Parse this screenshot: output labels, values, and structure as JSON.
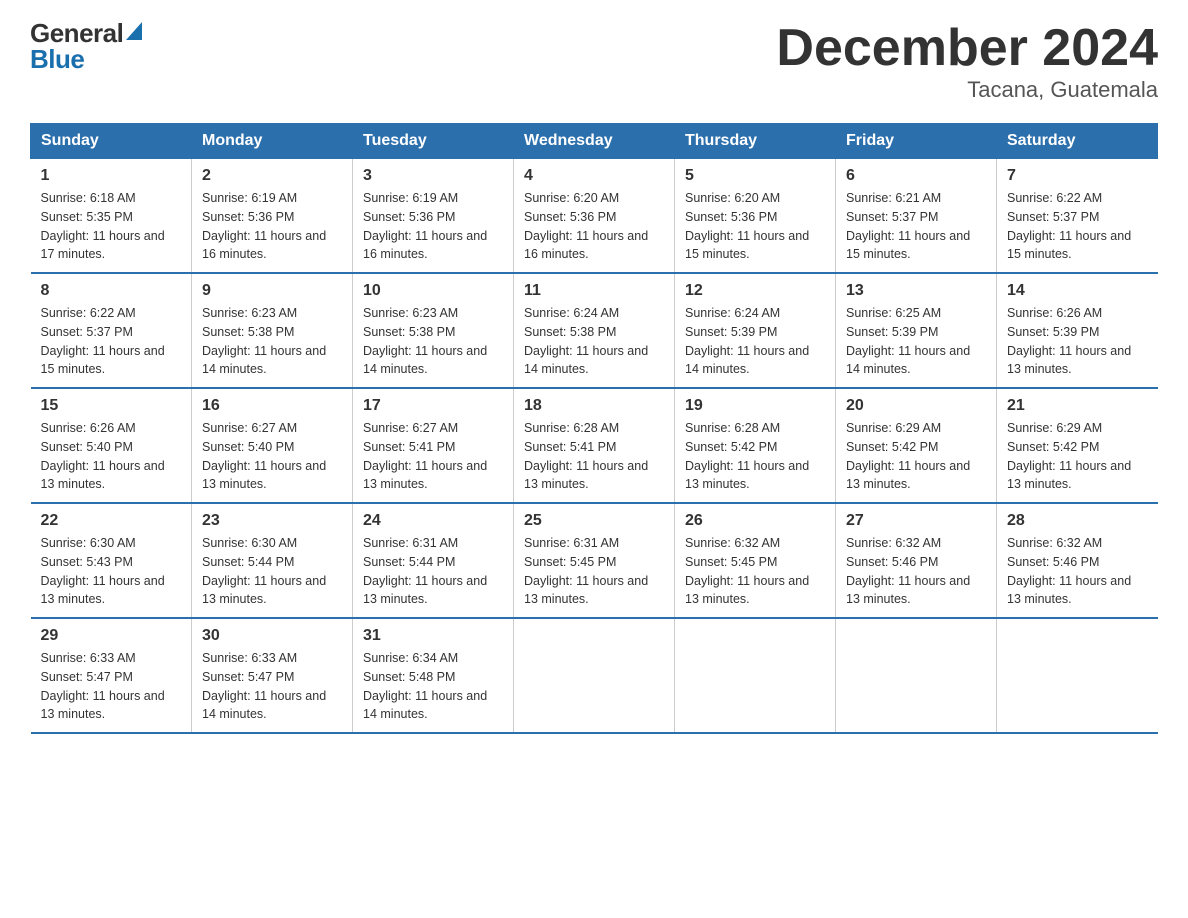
{
  "logo": {
    "general": "General",
    "blue": "Blue"
  },
  "title": "December 2024",
  "subtitle": "Tacana, Guatemala",
  "days_header": [
    "Sunday",
    "Monday",
    "Tuesday",
    "Wednesday",
    "Thursday",
    "Friday",
    "Saturday"
  ],
  "weeks": [
    [
      {
        "day": "1",
        "sunrise": "6:18 AM",
        "sunset": "5:35 PM",
        "daylight": "11 hours and 17 minutes."
      },
      {
        "day": "2",
        "sunrise": "6:19 AM",
        "sunset": "5:36 PM",
        "daylight": "11 hours and 16 minutes."
      },
      {
        "day": "3",
        "sunrise": "6:19 AM",
        "sunset": "5:36 PM",
        "daylight": "11 hours and 16 minutes."
      },
      {
        "day": "4",
        "sunrise": "6:20 AM",
        "sunset": "5:36 PM",
        "daylight": "11 hours and 16 minutes."
      },
      {
        "day": "5",
        "sunrise": "6:20 AM",
        "sunset": "5:36 PM",
        "daylight": "11 hours and 15 minutes."
      },
      {
        "day": "6",
        "sunrise": "6:21 AM",
        "sunset": "5:37 PM",
        "daylight": "11 hours and 15 minutes."
      },
      {
        "day": "7",
        "sunrise": "6:22 AM",
        "sunset": "5:37 PM",
        "daylight": "11 hours and 15 minutes."
      }
    ],
    [
      {
        "day": "8",
        "sunrise": "6:22 AM",
        "sunset": "5:37 PM",
        "daylight": "11 hours and 15 minutes."
      },
      {
        "day": "9",
        "sunrise": "6:23 AM",
        "sunset": "5:38 PM",
        "daylight": "11 hours and 14 minutes."
      },
      {
        "day": "10",
        "sunrise": "6:23 AM",
        "sunset": "5:38 PM",
        "daylight": "11 hours and 14 minutes."
      },
      {
        "day": "11",
        "sunrise": "6:24 AM",
        "sunset": "5:38 PM",
        "daylight": "11 hours and 14 minutes."
      },
      {
        "day": "12",
        "sunrise": "6:24 AM",
        "sunset": "5:39 PM",
        "daylight": "11 hours and 14 minutes."
      },
      {
        "day": "13",
        "sunrise": "6:25 AM",
        "sunset": "5:39 PM",
        "daylight": "11 hours and 14 minutes."
      },
      {
        "day": "14",
        "sunrise": "6:26 AM",
        "sunset": "5:39 PM",
        "daylight": "11 hours and 13 minutes."
      }
    ],
    [
      {
        "day": "15",
        "sunrise": "6:26 AM",
        "sunset": "5:40 PM",
        "daylight": "11 hours and 13 minutes."
      },
      {
        "day": "16",
        "sunrise": "6:27 AM",
        "sunset": "5:40 PM",
        "daylight": "11 hours and 13 minutes."
      },
      {
        "day": "17",
        "sunrise": "6:27 AM",
        "sunset": "5:41 PM",
        "daylight": "11 hours and 13 minutes."
      },
      {
        "day": "18",
        "sunrise": "6:28 AM",
        "sunset": "5:41 PM",
        "daylight": "11 hours and 13 minutes."
      },
      {
        "day": "19",
        "sunrise": "6:28 AM",
        "sunset": "5:42 PM",
        "daylight": "11 hours and 13 minutes."
      },
      {
        "day": "20",
        "sunrise": "6:29 AM",
        "sunset": "5:42 PM",
        "daylight": "11 hours and 13 minutes."
      },
      {
        "day": "21",
        "sunrise": "6:29 AM",
        "sunset": "5:42 PM",
        "daylight": "11 hours and 13 minutes."
      }
    ],
    [
      {
        "day": "22",
        "sunrise": "6:30 AM",
        "sunset": "5:43 PM",
        "daylight": "11 hours and 13 minutes."
      },
      {
        "day": "23",
        "sunrise": "6:30 AM",
        "sunset": "5:44 PM",
        "daylight": "11 hours and 13 minutes."
      },
      {
        "day": "24",
        "sunrise": "6:31 AM",
        "sunset": "5:44 PM",
        "daylight": "11 hours and 13 minutes."
      },
      {
        "day": "25",
        "sunrise": "6:31 AM",
        "sunset": "5:45 PM",
        "daylight": "11 hours and 13 minutes."
      },
      {
        "day": "26",
        "sunrise": "6:32 AM",
        "sunset": "5:45 PM",
        "daylight": "11 hours and 13 minutes."
      },
      {
        "day": "27",
        "sunrise": "6:32 AM",
        "sunset": "5:46 PM",
        "daylight": "11 hours and 13 minutes."
      },
      {
        "day": "28",
        "sunrise": "6:32 AM",
        "sunset": "5:46 PM",
        "daylight": "11 hours and 13 minutes."
      }
    ],
    [
      {
        "day": "29",
        "sunrise": "6:33 AM",
        "sunset": "5:47 PM",
        "daylight": "11 hours and 13 minutes."
      },
      {
        "day": "30",
        "sunrise": "6:33 AM",
        "sunset": "5:47 PM",
        "daylight": "11 hours and 14 minutes."
      },
      {
        "day": "31",
        "sunrise": "6:34 AM",
        "sunset": "5:48 PM",
        "daylight": "11 hours and 14 minutes."
      },
      null,
      null,
      null,
      null
    ]
  ]
}
